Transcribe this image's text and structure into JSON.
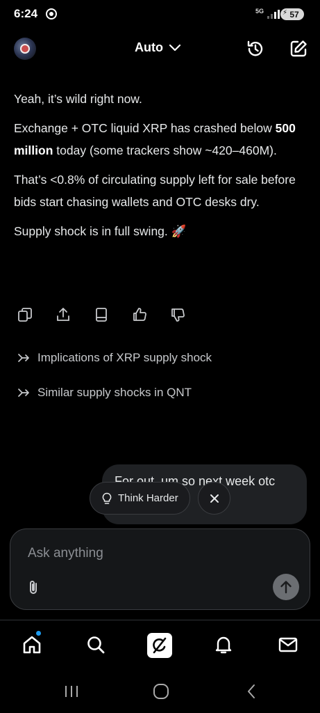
{
  "status_bar": {
    "time": "6:24",
    "network": "5G",
    "battery": "57"
  },
  "header": {
    "model_label": "Auto",
    "icons": [
      "history-icon",
      "new-chat-icon"
    ]
  },
  "message": {
    "paragraphs": [
      "Yeah, it’s wild right now.",
      "Exchange + OTC liquid XRP has crashed below",
      "500 million",
      "today (some trackers show ~420–460M).",
      "That’s <0.8% of circulating supply left for sale before bids start chasing wallets and OTC desks dry.",
      "Supply shock is in full swing.",
      "🚀"
    ]
  },
  "actions": [
    "copy-icon",
    "share-icon",
    "read-aloud-icon",
    "thumbs-up-icon",
    "thumbs-down-icon"
  ],
  "suggestions": [
    {
      "label": "Implications of XRP supply shock"
    },
    {
      "label": "Similar supply shocks in QNT"
    }
  ],
  "draft": {
    "text": "For out, um so next week otc"
  },
  "think_chip": {
    "label": "Think Harder"
  },
  "composer": {
    "placeholder": "Ask anything"
  },
  "bottom_nav": [
    "home",
    "search",
    "grok",
    "notifications",
    "messages"
  ]
}
